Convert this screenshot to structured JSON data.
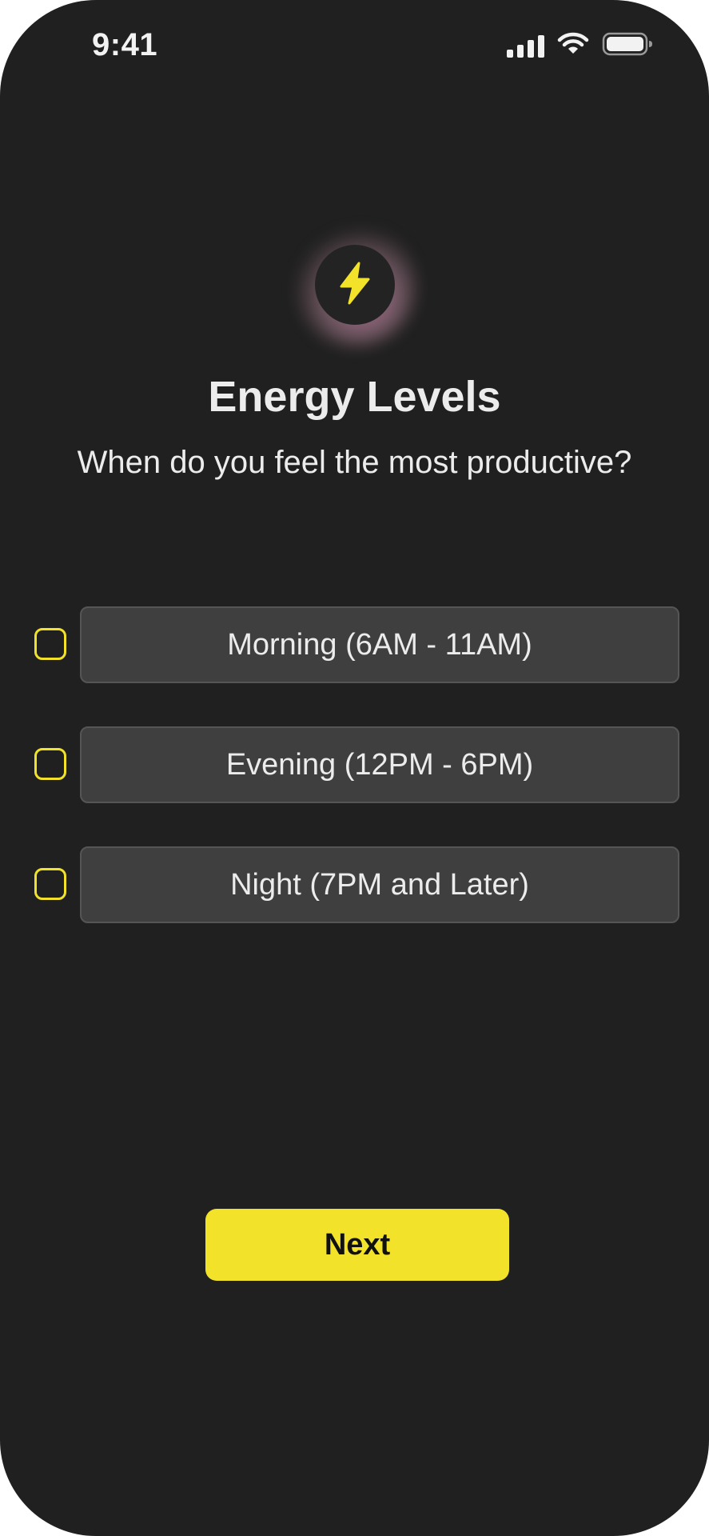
{
  "status_bar": {
    "time": "9:41",
    "icons": [
      "cellular-signal-icon",
      "wifi-icon",
      "battery-icon"
    ]
  },
  "header": {
    "icon": "lightning-bolt-icon",
    "title": "Energy Levels",
    "subtitle": "When do you feel the most productive?"
  },
  "options": [
    {
      "label": "Morning (6AM - 11AM)",
      "checked": false
    },
    {
      "label": "Evening (12PM - 6PM)",
      "checked": false
    },
    {
      "label": "Night (7PM and Later)",
      "checked": false
    }
  ],
  "actions": {
    "next_label": "Next"
  },
  "colors": {
    "background": "#202020",
    "accent": "#f3e22a",
    "option_fill": "#3f3f3f",
    "text": "#ececec"
  }
}
